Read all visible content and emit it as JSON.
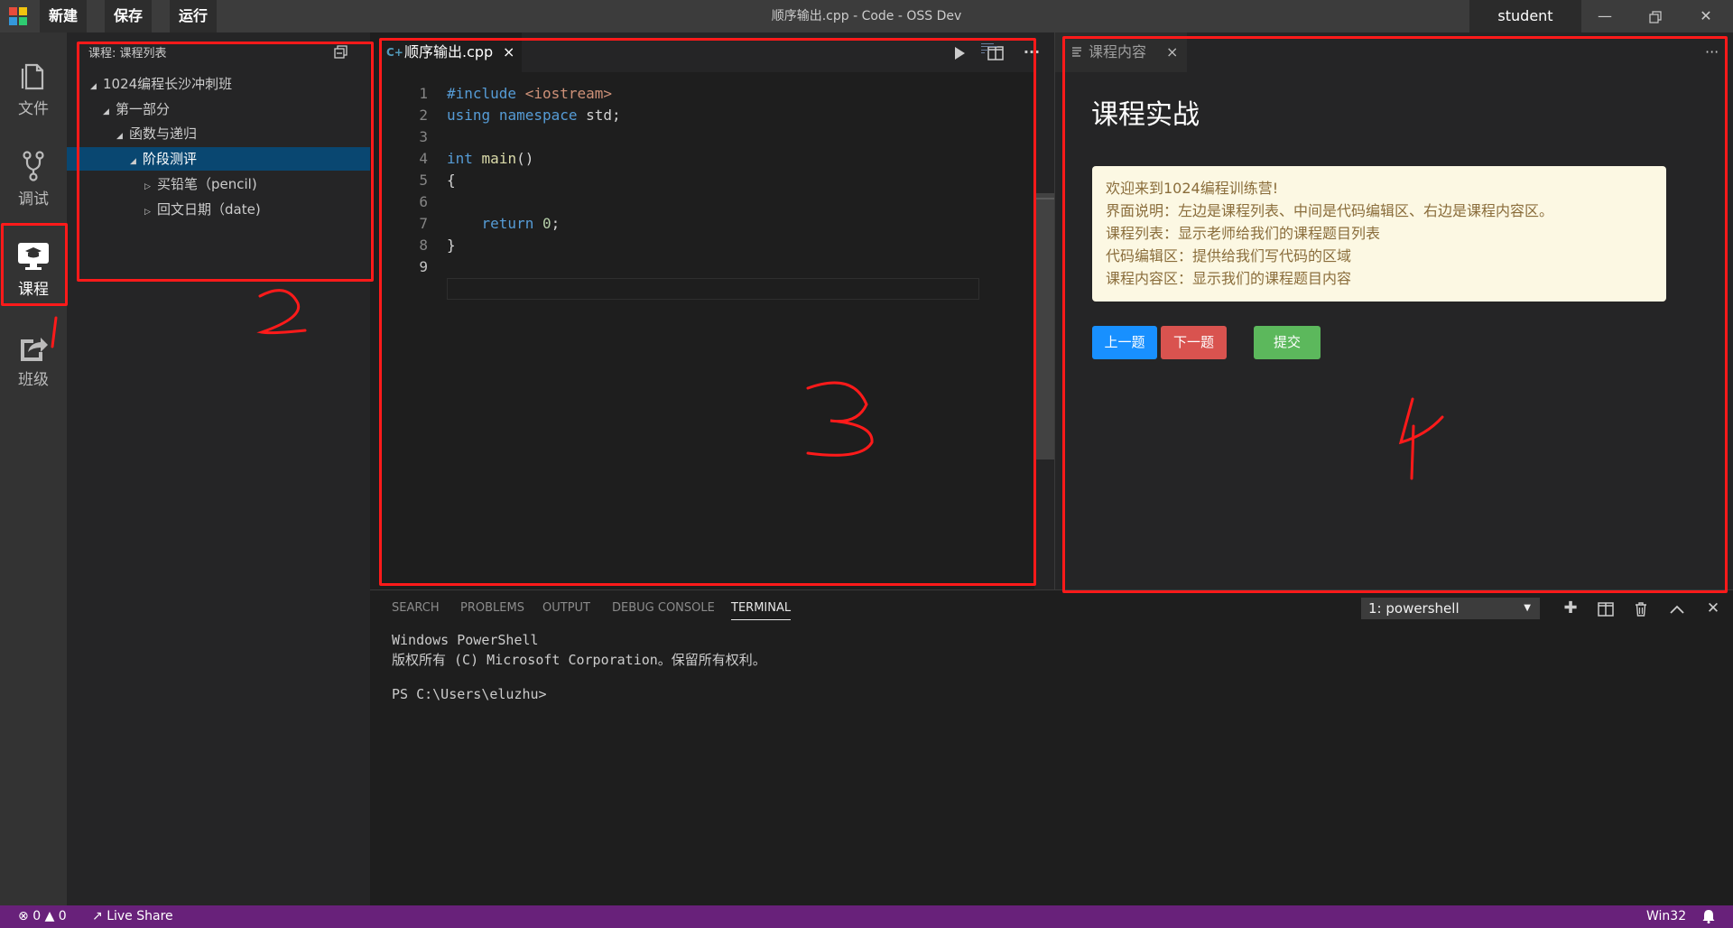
{
  "titlebar": {
    "menu": [
      "新建",
      "保存",
      "运行"
    ],
    "title": "顺序输出.cpp - Code - OSS Dev",
    "user": "student",
    "logo_colors": [
      "#e74c3c",
      "#f1c40f",
      "#3498db",
      "#2ecc71"
    ]
  },
  "activity": [
    {
      "icon": "file-icon",
      "label": "文件"
    },
    {
      "icon": "debug-branch-icon",
      "label": "调试"
    },
    {
      "icon": "course-graduation-icon",
      "label": "课程"
    },
    {
      "icon": "class-share-icon",
      "label": "班级"
    }
  ],
  "sidebar": {
    "title": "课程: 课程列表",
    "tree": [
      {
        "label": "1024编程长沙冲刺班",
        "expanded": true
      },
      {
        "label": "第一部分",
        "expanded": true
      },
      {
        "label": "函数与递归",
        "expanded": true
      },
      {
        "label": "阶段测评",
        "expanded": true,
        "selected": true
      },
      {
        "label": "买铅笔（pencil)",
        "expanded": false
      },
      {
        "label": "回文日期（date)",
        "expanded": false
      }
    ]
  },
  "editor": {
    "tab": "顺序输出.cpp",
    "tab_close": "×",
    "line_numbers": [
      "1",
      "2",
      "3",
      "4",
      "5",
      "6",
      "7",
      "8",
      "9"
    ],
    "code": [
      [
        {
          "t": "#include",
          "c": "kw"
        },
        {
          "t": " "
        },
        {
          "t": "<iostream>",
          "c": "str"
        }
      ],
      [
        {
          "t": "using",
          "c": "kw"
        },
        {
          "t": " "
        },
        {
          "t": "namespace",
          "c": "kw"
        },
        {
          "t": " std;"
        }
      ],
      [],
      [
        {
          "t": "int",
          "c": "kw"
        },
        {
          "t": " "
        },
        {
          "t": "main",
          "c": "fn"
        },
        {
          "t": "()"
        }
      ],
      [
        {
          "t": "{"
        }
      ],
      [],
      [
        {
          "t": "    "
        },
        {
          "t": "return",
          "c": "kw"
        },
        {
          "t": " "
        },
        {
          "t": "0",
          "c": "num"
        },
        {
          "t": ";"
        }
      ],
      [
        {
          "t": "}"
        }
      ],
      []
    ]
  },
  "right_panel": {
    "tab": "课程内容",
    "tab_close": "×",
    "heading": "课程实战",
    "notice": [
      "欢迎来到1024编程训练营!",
      "界面说明：左边是课程列表、中间是代码编辑区、右边是课程内容区。",
      "课程列表：显示老师给我们的课程题目列表",
      "代码编辑区：提供给我们写代码的区域",
      "课程内容区：显示我们的课程题目内容"
    ],
    "buttons": {
      "prev": "上一题",
      "next": "下一题",
      "submit": "提交"
    },
    "button_colors": {
      "prev": "#1890ff",
      "next": "#d9534f",
      "submit": "#5cb85c"
    }
  },
  "panel": {
    "tabs": [
      "SEARCH",
      "PROBLEMS",
      "OUTPUT",
      "DEBUG CONSOLE",
      "TERMINAL"
    ],
    "active_tab": "TERMINAL",
    "terminal_select": "1: powershell",
    "terminal_lines": [
      "Windows PowerShell",
      "版权所有 (C) Microsoft Corporation。保留所有权利。",
      "",
      "PS C:\\Users\\eluzhu>"
    ]
  },
  "statusbar": {
    "errors": "0",
    "warnings": "0",
    "live_share": "Live Share",
    "platform": "Win32",
    "color": "#68217a"
  },
  "annotations": {
    "color": "#ff1a1a",
    "labels": [
      "1",
      "2",
      "3",
      "4"
    ]
  }
}
